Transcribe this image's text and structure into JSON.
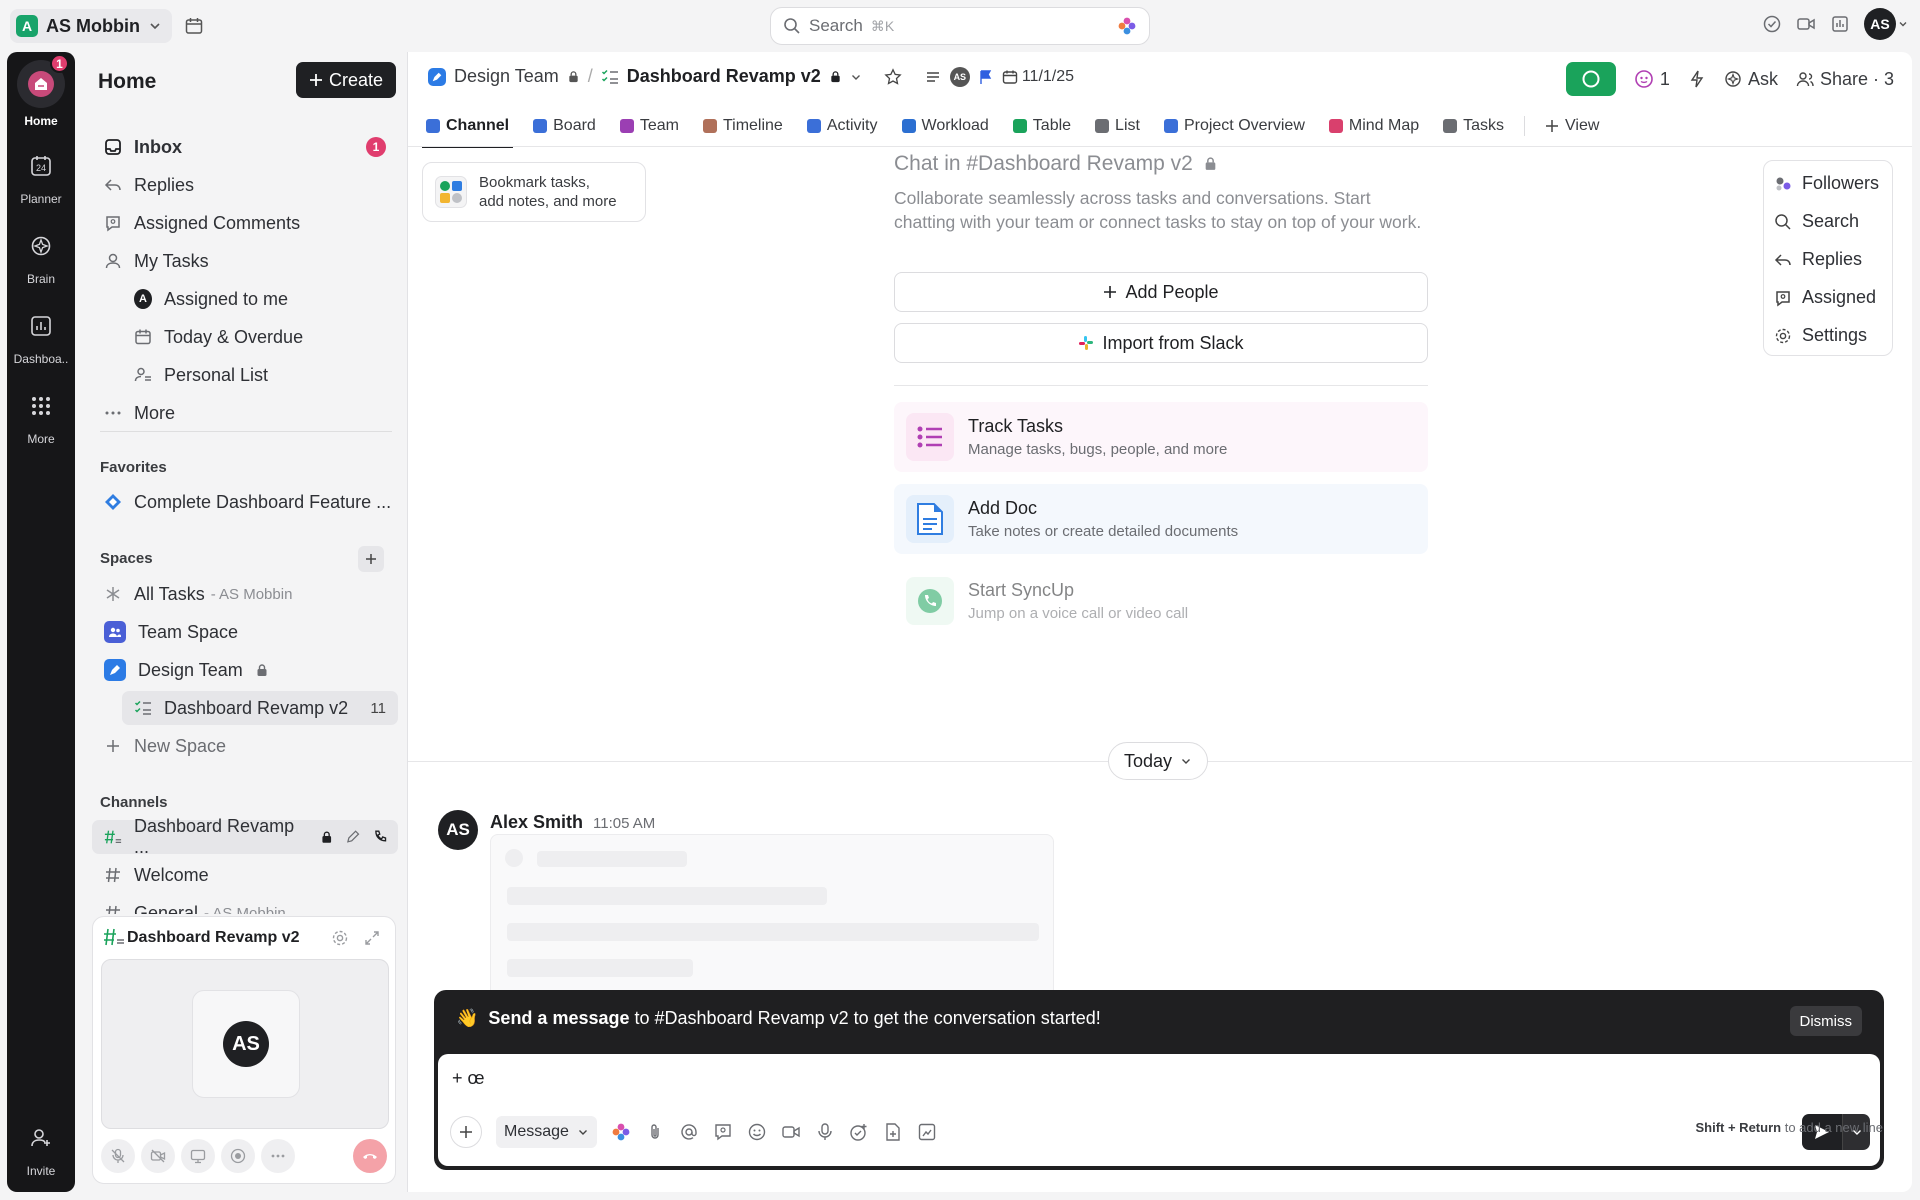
{
  "topbar": {
    "workspace_initial": "A",
    "workspace_name": "AS Mobbin",
    "search_placeholder": "Search",
    "search_shortcut": "⌘K",
    "user_initials": "AS"
  },
  "rail": {
    "items": [
      {
        "label": "Home",
        "badge": "1"
      },
      {
        "label": "Planner",
        "day": "24"
      },
      {
        "label": "Brain"
      },
      {
        "label": "Dashboa.."
      },
      {
        "label": "More"
      },
      {
        "label": "Invite"
      }
    ]
  },
  "sidebar": {
    "title": "Home",
    "create_label": "Create",
    "nav": [
      {
        "label": "Inbox",
        "badge": "1"
      },
      {
        "label": "Replies"
      },
      {
        "label": "Assigned Comments"
      },
      {
        "label": "My Tasks"
      },
      {
        "label": "Assigned to me",
        "avatar": "A"
      },
      {
        "label": "Today & Overdue"
      },
      {
        "label": "Personal List"
      },
      {
        "label": "More"
      }
    ],
    "favorites_heading": "Favorites",
    "favorites": [
      {
        "label": "Complete Dashboard Feature ..."
      }
    ],
    "spaces_heading": "Spaces",
    "spaces": [
      {
        "label": "All Tasks",
        "suffix": "- AS Mobbin"
      },
      {
        "label": "Team Space"
      },
      {
        "label": "Design Team"
      },
      {
        "label": "Dashboard Revamp v2",
        "count": "11"
      },
      {
        "label": "New Space"
      }
    ],
    "channels_heading": "Channels",
    "channels": [
      {
        "label": "Dashboard Revamp ..."
      },
      {
        "label": "Welcome"
      },
      {
        "label": "General",
        "suffix": "- AS Mobbin"
      }
    ]
  },
  "call": {
    "title": "Dashboard Revamp v2",
    "participant_initials": "AS"
  },
  "header": {
    "breadcrumb_space": "Design Team",
    "breadcrumb_list": "Dashboard Revamp v2",
    "avatar_initials": "AS",
    "date": "11/1/25",
    "ai_count": "1",
    "ask_label": "Ask",
    "share_label": "Share · 3"
  },
  "tabs": [
    {
      "label": "Channel",
      "color": "#3b6fd8"
    },
    {
      "label": "Board",
      "color": "#3b6fd8"
    },
    {
      "label": "Team",
      "color": "#9b3fb3"
    },
    {
      "label": "Timeline",
      "color": "#b0705a"
    },
    {
      "label": "Activity",
      "color": "#3b6fd8"
    },
    {
      "label": "Workload",
      "color": "#2c6fd1"
    },
    {
      "label": "Table",
      "color": "#1aa35b"
    },
    {
      "label": "List",
      "color": "#6b6d72"
    },
    {
      "label": "Project Overview",
      "color": "#3b6fd8"
    },
    {
      "label": "Mind Map",
      "color": "#d9406d"
    },
    {
      "label": "Tasks",
      "color": "#6b6d72"
    }
  ],
  "add_view_label": "View",
  "bookmark": {
    "line1": "Bookmark tasks,",
    "line2": "add notes, and more"
  },
  "chat_intro": {
    "title": "Chat in #Dashboard Revamp v2",
    "description": "Collaborate seamlessly across tasks and conversations. Start chatting with your team or connect tasks to stay on top of your work.",
    "add_people": "Add People",
    "import_slack": "Import from Slack"
  },
  "features": [
    {
      "title": "Track Tasks",
      "subtitle": "Manage tasks, bugs, people, and more"
    },
    {
      "title": "Add Doc",
      "subtitle": "Take notes or create detailed documents"
    },
    {
      "title": "Start SyncUp",
      "subtitle": "Jump on a voice call or video call"
    }
  ],
  "right_panel": [
    {
      "label": "Followers"
    },
    {
      "label": "Search"
    },
    {
      "label": "Replies"
    },
    {
      "label": "Assigned"
    },
    {
      "label": "Settings"
    }
  ],
  "divider_label": "Today",
  "message": {
    "author": "Alex Smith",
    "initials": "AS",
    "time": "11:05 AM"
  },
  "composer": {
    "emoji": "👋",
    "banner_bold": "Send a message",
    "banner_rest": "to #Dashboard Revamp v2 to get the conversation started!",
    "dismiss": "Dismiss",
    "input_value": "+ œ",
    "mode": "Message"
  },
  "hint": {
    "keys": "Shift + Return",
    "text": "to add a new line"
  }
}
